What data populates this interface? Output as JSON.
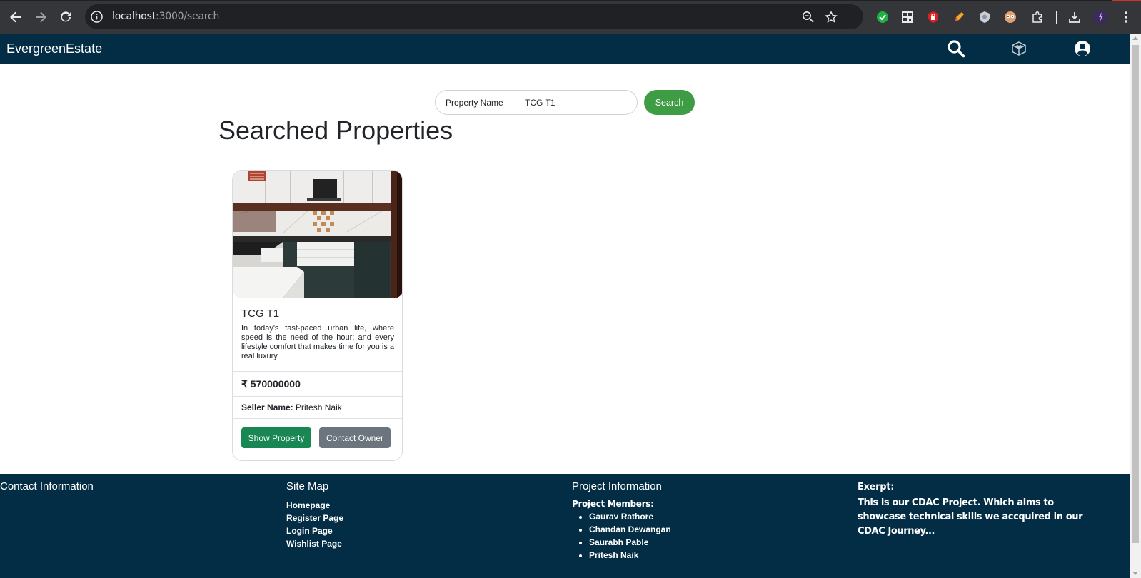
{
  "browser": {
    "url_host": "localhost",
    "url_path": ":3000/search"
  },
  "header": {
    "brand": "EvergreenEstate"
  },
  "search": {
    "label": "Property Name",
    "value": "TCG T1",
    "button_label": "Search"
  },
  "main": {
    "title": "Searched Properties"
  },
  "properties": [
    {
      "name": "TCG T1",
      "description": "In today's fast-paced urban life, where speed is the need of the hour; and every lifestyle comfort that makes time for you is a real luxury,",
      "price": "₹ 570000000",
      "seller_label": "Seller Name:",
      "seller_name": "Pritesh Naik",
      "show_button": "Show Property",
      "contact_button": "Contact Owner"
    }
  ],
  "footer": {
    "contact": {
      "heading": "Contact Information"
    },
    "sitemap": {
      "heading": "Site Map",
      "links": [
        "Homepage",
        "Register Page",
        "Login Page",
        "Wishlist Page"
      ]
    },
    "project": {
      "heading": "Project Information",
      "members_label": "Project Members:",
      "members": [
        "Gaurav Rathore",
        "Chandan Dewangan",
        "Saurabh Pable",
        "Pritesh Naik"
      ]
    },
    "excerpt": {
      "heading": "Exerpt:",
      "text": "This is our CDAC Project. Which aims to showcase technical skills we accquired in our CDAC Journey..."
    }
  },
  "colors": {
    "header_bg": "#022d44",
    "search_button": "#3e9d44",
    "show_button": "#198754",
    "contact_button": "#6c757d"
  }
}
